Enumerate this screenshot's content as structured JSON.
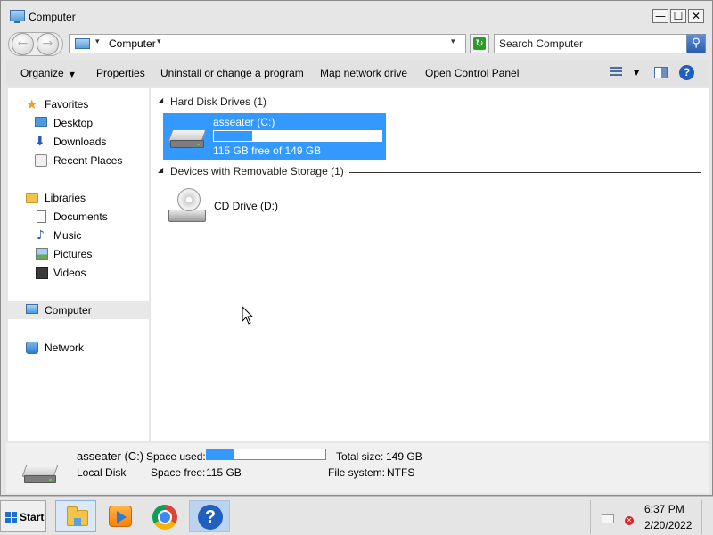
{
  "window": {
    "title": "Computer",
    "minimize_glyph": "—",
    "maximize_glyph": "☐",
    "close_glyph": "✕"
  },
  "navbar": {
    "back_glyph": "←",
    "forward_glyph": "→",
    "address": "Computer",
    "address_caret": "▾",
    "history_caret": "▾",
    "refresh_glyph": "↻",
    "search_placeholder": "Search Computer",
    "search_glyph": "⚲"
  },
  "toolbar": {
    "organize": "Organize",
    "properties": "Properties",
    "uninstall": "Uninstall or change a program",
    "map_drive": "Map network drive",
    "control_panel": "Open Control Panel",
    "help_glyph": "?"
  },
  "sidebar": {
    "favorites": "Favorites",
    "desktop": "Desktop",
    "downloads": "Downloads",
    "recent": "Recent Places",
    "libraries": "Libraries",
    "documents": "Documents",
    "music": "Music",
    "pictures": "Pictures",
    "videos": "Videos",
    "computer": "Computer",
    "network": "Network"
  },
  "content": {
    "group_hdd": "Hard Disk Drives (1)",
    "group_removable": "Devices with Removable Storage (1)",
    "drive_c": {
      "name": "asseater (C:)",
      "free_text": "115 GB free of 149 GB",
      "used_fraction": 0.23
    },
    "drive_d": {
      "name": "CD Drive (D:)"
    }
  },
  "details": {
    "name": "asseater (C:)",
    "type": "Local Disk",
    "space_used_label": "Space used:",
    "space_free_label": "Space free:",
    "space_free_value": "115 GB",
    "total_size_label": "Total size:",
    "total_size_value": "149 GB",
    "file_system_label": "File system:",
    "file_system_value": "NTFS",
    "used_fraction": 0.23
  },
  "taskbar": {
    "start": "Start",
    "help_glyph": "?",
    "time": "6:37 PM",
    "date": "2/20/2022"
  },
  "colors": {
    "selection": "#3399ff",
    "accent": "#1f5fbf"
  }
}
